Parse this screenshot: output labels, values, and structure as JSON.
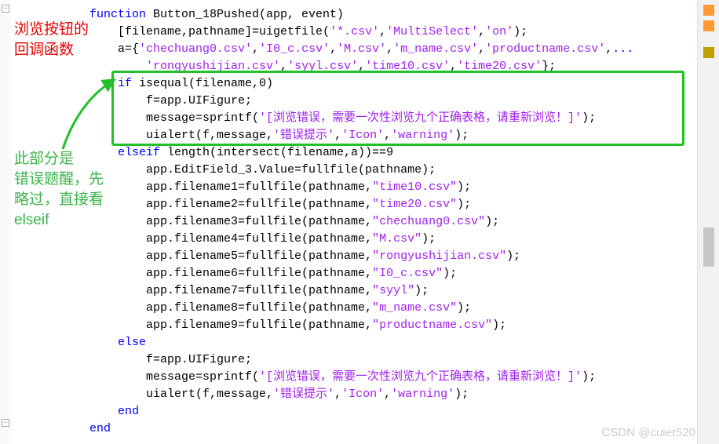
{
  "code": {
    "l1a": "function",
    "l1b": " Button_18Pushed(app, event)",
    "l2a": "    [filename,pathname]=uigetfile(",
    "l2b": "'*.csv'",
    "l2c": ",",
    "l2d": "'MultiSelect'",
    "l2e": ",",
    "l2f": "'on'",
    "l2g": ");",
    "l3a": "    a={",
    "l3b": "'chechuang0.csv'",
    "l3c": ",",
    "l3d": "'I0_c.csv'",
    "l3e": ",",
    "l3f": "'M.csv'",
    "l3g": ",",
    "l3h": "'m_name.csv'",
    "l3i": ",",
    "l3j": "'productname.csv'",
    "l3k": ",",
    "l3l": "...",
    "l4a": "        ",
    "l4b": "'rongyushijian.csv'",
    "l4c": ",",
    "l4d": "'syyl.csv'",
    "l4e": ",",
    "l4f": "'time10.csv'",
    "l4g": ",",
    "l4h": "'time20.csv'",
    "l4i": "};",
    "l5a": "    if",
    "l5b": " isequal(filename,0)",
    "l6": "        f=app.UIFigure;",
    "l7a": "        message=sprintf(",
    "l7b": "'[浏览错误，需要一次性浏览九个正确表格，请重新浏览！]'",
    "l7c": ");",
    "l8a": "        uialert(f,message,",
    "l8b": "'错误提示'",
    "l8c": ",",
    "l8d": "'Icon'",
    "l8e": ",",
    "l8f": "'warning'",
    "l8g": ");",
    "l9a": "    elseif",
    "l9b": " length(intersect(filename,a))==9",
    "l10": "        app.EditField_3.Value=fullfile(pathname);",
    "l11a": "        app.filename1=fullfile(pathname,",
    "l11b": "\"time10.csv\"",
    "l11c": ");",
    "l12a": "        app.filename2=fullfile(pathname,",
    "l12b": "\"time20.csv\"",
    "l12c": ");",
    "l13a": "        app.filename3=fullfile(pathname,",
    "l13b": "\"chechuang0.csv\"",
    "l13c": ");",
    "l14a": "        app.filename4=fullfile(pathname,",
    "l14b": "\"M.csv\"",
    "l14c": ");",
    "l15a": "        app.filename5=fullfile(pathname,",
    "l15b": "\"rongyushijian.csv\"",
    "l15c": ");",
    "l16a": "        app.filename6=fullfile(pathname,",
    "l16b": "\"I0_c.csv\"",
    "l16c": ");",
    "l17a": "        app.filename7=fullfile(pathname,",
    "l17b": "\"syyl\"",
    "l17c": ");",
    "l18a": "        app.filename8=fullfile(pathname,",
    "l18b": "\"m_name.csv\"",
    "l18c": ");",
    "l19a": "        app.filename9=fullfile(pathname,",
    "l19b": "\"productname.csv\"",
    "l19c": ");",
    "l20a": "    else",
    "l21": "        f=app.UIFigure;",
    "l22a": "        message=sprintf(",
    "l22b": "'[浏览错误，需要一次性浏览九个正确表格，请重新浏览！]'",
    "l22c": ");",
    "l23a": "        uialert(f,message,",
    "l23b": "'错误提示'",
    "l23c": ",",
    "l23d": "'Icon'",
    "l23e": ",",
    "l23f": "'warning'",
    "l23g": ");",
    "l24a": "    end",
    "l25a": "end"
  },
  "annotations": {
    "red_line1": "浏览按钮的",
    "red_line2": "回调函数",
    "green_line1": "此部分是",
    "green_line2": "错误题醒，先",
    "green_line3": "略过，直接看",
    "green_line4": "elseif"
  },
  "rightbar": {
    "color_top": "#ff9933",
    "color_mid": "#c0a000",
    "color_scroll": "#c0c0c0"
  },
  "watermark": "CSDN @cuier520"
}
